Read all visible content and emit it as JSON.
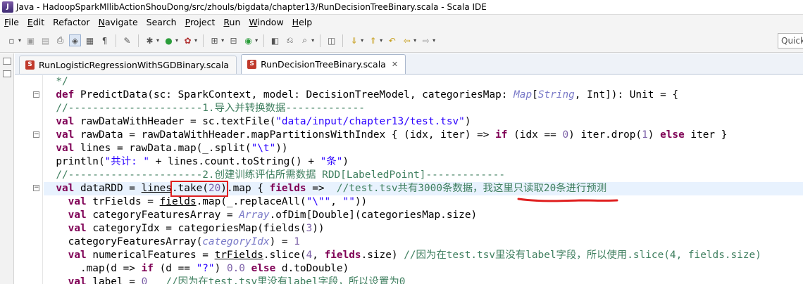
{
  "window": {
    "title": "Java - HadoopSparkMllibActionShouDong/src/zhouls/bigdata/chapter13/RunDecisionTreeBinary.scala - Scala IDE",
    "app_icon": "eclipse-java-icon"
  },
  "menu": [
    {
      "label": "File",
      "mnemonic": "F",
      "rest": "ile"
    },
    {
      "label": "Edit",
      "mnemonic": "E",
      "rest": "dit"
    },
    {
      "label": "Refactor",
      "mnemonic": "",
      "rest": "Refactor"
    },
    {
      "label": "Navigate",
      "mnemonic": "N",
      "rest": "avigate"
    },
    {
      "label": "Search",
      "mnemonic": "",
      "rest": "Search"
    },
    {
      "label": "Project",
      "mnemonic": "P",
      "rest": "roject"
    },
    {
      "label": "Run",
      "mnemonic": "R",
      "rest": "un"
    },
    {
      "label": "Window",
      "mnemonic": "W",
      "rest": "indow"
    },
    {
      "label": "Help",
      "mnemonic": "H",
      "rest": "elp"
    }
  ],
  "toolbar": {
    "quick_access_placeholder": "Quick"
  },
  "tabs": [
    {
      "label": "RunLogisticRegressionWithSGDBinary.scala",
      "active": false
    },
    {
      "label": "RunDecisionTreeBinary.scala",
      "active": true,
      "close": "✕"
    }
  ],
  "code": {
    "l0": "  */",
    "l1_kw": "def",
    "l1_a": " PredictData(sc: SparkContext, model: DecisionTreeModel, categoriesMap: ",
    "l1_t1": "Map",
    "l1_b": "[",
    "l1_t2": "String",
    "l1_c": ", Int]): Unit = {",
    "l2": "  //----------------------1.导入并转换数据-------------",
    "l3_kw": "val",
    "l3_a": " rawDataWithHeader = sc.textFile(",
    "l3_s": "\"data/input/chapter13/test.tsv\"",
    "l3_b": ")",
    "l4_kw": "val",
    "l4_a": " rawData = rawDataWithHeader.mapPartitionsWithIndex { (idx, iter) => ",
    "l4_kw2": "if",
    "l4_b": " (idx == ",
    "l4_n1": "0",
    "l4_c": ") iter.drop(",
    "l4_n2": "1",
    "l4_d": ") ",
    "l4_kw3": "else",
    "l4_e": " iter }",
    "l5_kw": "val",
    "l5_a": " lines = rawData.map(_.split(",
    "l5_s": "\"\\t\"",
    "l5_b": "))",
    "l6_a": "  println(",
    "l6_s1": "\"共计: \"",
    "l6_b": " + lines.count.toString() + ",
    "l6_s2": "\"条\"",
    "l6_c": ")",
    "l7": "  //----------------------2.创建训练评估所需数据 RDD[LabeledPoint]-------------",
    "l8_kw": "val",
    "l8_a": " dataRDD = ",
    "l8_u": "lines",
    "l8_box_a": ".take(",
    "l8_box_n": "20",
    "l8_box_b": ")",
    "l8_b": ".map { ",
    "l8_kw2": "fields",
    "l8_c": " =>  ",
    "l8_cm": "//test.tsv共有3000条数据，我这里只读取20条进行预测",
    "l9_kw": "val",
    "l9_a": " trFields = ",
    "l9_u": "fields",
    "l9_b": ".map(_.replaceAll(",
    "l9_s1": "\"\\\"\"",
    "l9_c": ", ",
    "l9_s2": "\"\"",
    "l9_d": "))",
    "l10_kw": "val",
    "l10_a": " categoryFeaturesArray = ",
    "l10_t": "Array",
    "l10_b": ".ofDim[Double](categoriesMap.size)",
    "l11_kw": "val",
    "l11_a": " categoryIdx = categoriesMap(fields(",
    "l11_n": "3",
    "l11_b": "))",
    "l12_a": "    categoryFeaturesArray(",
    "l12_u": "categoryIdx",
    "l12_b": ") = ",
    "l12_n": "1",
    "l13_kw": "val",
    "l13_a": " numericalFeatures = ",
    "l13_u": "trFields",
    "l13_b": ".slice(",
    "l13_n": "4",
    "l13_c": ", ",
    "l13_kw2": "fields",
    "l13_d": ".size) ",
    "l13_cm": "//因为在test.tsv里没有label字段，所以使用.slice(4, fields.size)",
    "l14_a": "      .map(d => ",
    "l14_kw": "if",
    "l14_b": " (d == ",
    "l14_s": "\"?\"",
    "l14_c": ") ",
    "l14_n": "0.0",
    "l14_kw2": " else",
    "l14_d": " d.toDouble)",
    "l15_kw": "val",
    "l15_a": " label = ",
    "l15_n": "0",
    "l15_cm": "   //因为在test.tsv里没有label字段，所以设置为0"
  }
}
